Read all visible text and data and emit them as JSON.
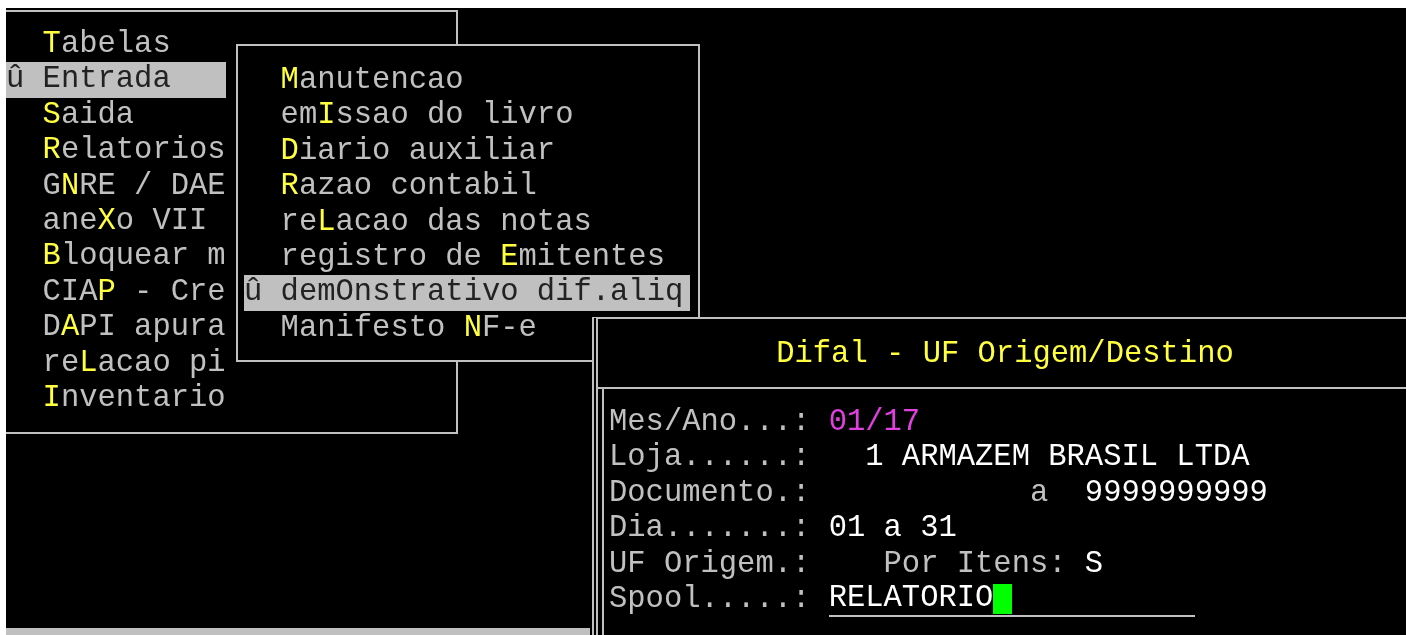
{
  "main_menu": {
    "items": [
      {
        "selected": false,
        "key": "T",
        "after": "abelas"
      },
      {
        "selected": true,
        "marker": "û",
        "key": "E",
        "after": "ntrada"
      },
      {
        "selected": false,
        "key": "S",
        "after": "aida"
      },
      {
        "selected": false,
        "key": "R",
        "after": "elatorios"
      },
      {
        "selected": false,
        "before": "G",
        "key": "N",
        "after": "RE / DAE"
      },
      {
        "selected": false,
        "before": "ane",
        "key": "X",
        "after": "o VII"
      },
      {
        "selected": false,
        "key": "B",
        "after": "loquear m"
      },
      {
        "selected": false,
        "before": "CIA",
        "key": "P",
        "after": " - Cre"
      },
      {
        "selected": false,
        "before": "D",
        "key": "A",
        "after": "PI apura"
      },
      {
        "selected": false,
        "before": "re",
        "key": "L",
        "after": "acao pi"
      },
      {
        "selected": false,
        "key": "I",
        "after": "nventario"
      }
    ]
  },
  "submenu": {
    "items": [
      {
        "selected": false,
        "key": "M",
        "after": "anutencao"
      },
      {
        "selected": false,
        "before": "em",
        "key": "I",
        "after": "ssao do livro"
      },
      {
        "selected": false,
        "key": "D",
        "after": "iario auxiliar"
      },
      {
        "selected": false,
        "key": "R",
        "after": "azao contabil"
      },
      {
        "selected": false,
        "before": "re",
        "key": "L",
        "after": "acao das notas"
      },
      {
        "selected": false,
        "before": "registro de ",
        "key": "E",
        "after": "mitentes"
      },
      {
        "selected": true,
        "marker": "û",
        "before": "dem",
        "key": "O",
        "after": "nstrativo dif.aliq"
      },
      {
        "selected": false,
        "before": "Manifesto ",
        "key": "N",
        "after": "F-e"
      }
    ]
  },
  "dialog": {
    "title": "Difal - UF Origem/Destino",
    "fields": [
      {
        "kind": "period",
        "label": "Mes/Ano...:",
        "value": "01/17"
      },
      {
        "kind": "store",
        "label": "Loja......:",
        "code": "1",
        "value": "ARMAZEM BRASIL LTDA"
      },
      {
        "kind": "range",
        "label": "Documento.:",
        "separator": "a",
        "value_to": "9999999999"
      },
      {
        "kind": "text",
        "label": "Dia.......:",
        "value": "01 a 31"
      },
      {
        "kind": "option",
        "label": "UF Origem.:",
        "option_label": "Por Itens:",
        "value": "S"
      },
      {
        "kind": "input",
        "label": "Spool.....:",
        "value": "RELATORIO"
      }
    ]
  }
}
